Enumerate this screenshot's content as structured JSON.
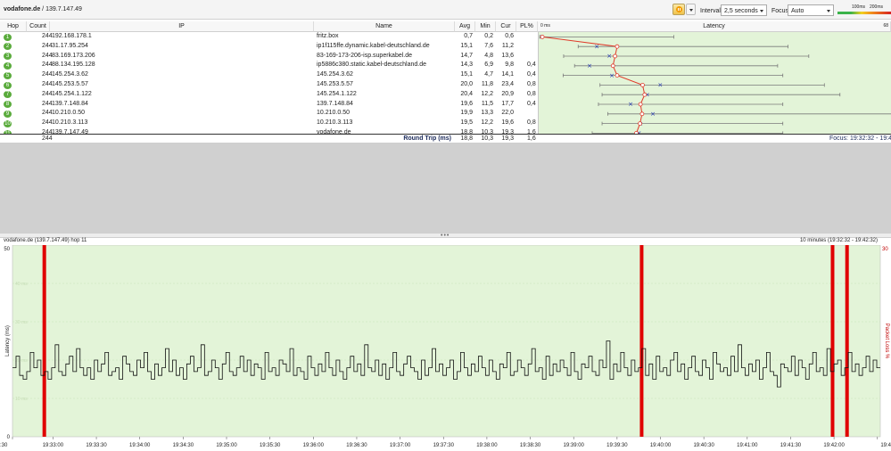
{
  "window": {
    "title_host": "vodafone.de",
    "title_ip": " / 139.7.147.49"
  },
  "toolbar": {
    "interval_label": "Interval",
    "interval_value": "2,5 seconds",
    "focus_label": "Focus",
    "focus_value": "Auto",
    "scale_100": "100ms",
    "scale_200": "200ms"
  },
  "table": {
    "headers": {
      "hop": "Hop",
      "count": "Count",
      "ip": "IP",
      "name": "Name",
      "avg": "Avg",
      "min": "Min",
      "cur": "Cur",
      "pl": "PL%",
      "latency": "Latency",
      "zero": "0 ms",
      "max": "68"
    },
    "rows": [
      {
        "hop": "1",
        "count": "244",
        "ip": "192.168.178.1",
        "name": "fritz.box",
        "avg": "0,7",
        "min": "0,2",
        "cur": "0,6",
        "pl": "",
        "pl_value": 0
      },
      {
        "hop": "2",
        "count": "244",
        "ip": "31.17.95.254",
        "name": "ip1f115ffe.dynamic.kabel-deutschland.de",
        "avg": "15,1",
        "min": "7,6",
        "cur": "11,2",
        "pl": "",
        "pl_value": 0
      },
      {
        "hop": "3",
        "count": "244",
        "ip": "83.169.173.206",
        "name": "83-169-173-206-isp.superkabel.de",
        "avg": "14,7",
        "min": "4,8",
        "cur": "13,6",
        "pl": "",
        "pl_value": 0
      },
      {
        "hop": "4",
        "count": "244",
        "ip": "88.134.195.128",
        "name": "ip5886c380.static.kabel-deutschland.de",
        "avg": "14,3",
        "min": "6,9",
        "cur": "9,8",
        "pl": "0,4",
        "pl_value": 0.4
      },
      {
        "hop": "5",
        "count": "244",
        "ip": "145.254.3.62",
        "name": "145.254.3.62",
        "avg": "15,1",
        "min": "4,7",
        "cur": "14,1",
        "pl": "0,4",
        "pl_value": 0.4
      },
      {
        "hop": "6",
        "count": "244",
        "ip": "145.253.5.57",
        "name": "145.253.5.57",
        "avg": "20,0",
        "min": "11,8",
        "cur": "23,4",
        "pl": "0,8",
        "pl_value": 0.8
      },
      {
        "hop": "7",
        "count": "244",
        "ip": "145.254.1.122",
        "name": "145.254.1.122",
        "avg": "20,4",
        "min": "12,2",
        "cur": "20,9",
        "pl": "0,8",
        "pl_value": 0.8
      },
      {
        "hop": "8",
        "count": "244",
        "ip": "139.7.148.84",
        "name": "139.7.148.84",
        "avg": "19,6",
        "min": "11,5",
        "cur": "17,7",
        "pl": "0,4",
        "pl_value": 0.4
      },
      {
        "hop": "9",
        "count": "244",
        "ip": "10.210.0.50",
        "name": "10.210.0.50",
        "avg": "19,9",
        "min": "13,3",
        "cur": "22,0",
        "pl": "",
        "pl_value": 0
      },
      {
        "hop": "10",
        "count": "244",
        "ip": "10.210.3.113",
        "name": "10.210.3.113",
        "avg": "19,5",
        "min": "12,2",
        "cur": "19,6",
        "pl": "0,8",
        "pl_value": 0.8
      },
      {
        "hop": "11",
        "count": "244",
        "ip": "139.7.147.49",
        "name": "vodafone.de",
        "avg": "18,8",
        "min": "10,3",
        "cur": "19,3",
        "pl": "1,6",
        "pl_value": 1.6
      }
    ],
    "summary": {
      "count": "244",
      "label": "Round Trip (ms)",
      "avg": "18,8",
      "min": "10,3",
      "cur": "19,3",
      "pl": "1,6",
      "focus": "Focus: 19:32:32 - 19:42:3"
    },
    "latency_graph": {
      "x_max_ms": 68,
      "max_ms": [
        26,
        48,
        52,
        46,
        47,
        55,
        58,
        47,
        70,
        47,
        47
      ],
      "min_ms": [
        0.2,
        7.6,
        4.8,
        6.9,
        4.7,
        11.8,
        12.2,
        11.5,
        13.3,
        12.2,
        10.3
      ]
    }
  },
  "chart_title": "vodafone.de (139.7.147.49) hop 11",
  "chart_range": "10 minutes (19:32:32 - 19:42:32)",
  "chart_data": {
    "type": "line",
    "ylabel": "Latency (ms)",
    "y2label": "Packet Loss %",
    "ylim": [
      0,
      50
    ],
    "y2_max_label": "30",
    "y_ticks": [
      "0",
      "50"
    ],
    "y_faint_ticks": [
      "10 ms",
      "20 ms",
      "30 ms",
      "40 ms"
    ],
    "x_ticks": [
      "19:32:30",
      "19:33:00",
      "19:33:30",
      "19:34:00",
      "19:34:30",
      "19:35:00",
      "19:35:30",
      "19:36:00",
      "19:36:30",
      "19:37:00",
      "19:37:30",
      "19:38:00",
      "19:38:30",
      "19:39:00",
      "19:39:30",
      "19:40:00",
      "19:40:30",
      "19:41:00",
      "19:41:30",
      "19:42:00",
      "19:42:30"
    ],
    "x_tick_display": [
      ":30",
      "19:33:00",
      "19:33:30",
      "19:34:00",
      "19:34:30",
      "19:35:00",
      "19:35:30",
      "19:36:00",
      "19:36:30",
      "19:37:00",
      "19:37:30",
      "19:38:00",
      "19:38:30",
      "19:39:00",
      "19:39:30",
      "19:40:00",
      "19:40:30",
      "19:41:00",
      "19:41:30",
      "19:42:00",
      "19:4"
    ],
    "time_range_s": [
      0,
      600
    ],
    "packet_loss_at_s": [
      22,
      435,
      567,
      577
    ],
    "latency_ms": [
      18,
      21,
      16,
      15,
      17,
      22,
      18,
      20,
      16,
      17,
      15,
      18,
      24,
      17,
      16,
      19,
      21,
      17,
      23,
      18,
      16,
      18,
      15,
      20,
      17,
      19,
      22,
      16,
      17,
      18,
      15,
      21,
      19,
      17,
      16,
      20,
      18,
      22,
      17,
      15,
      19,
      16,
      18,
      23,
      17,
      20,
      16,
      18,
      15,
      19,
      21,
      17,
      18,
      24,
      16,
      17,
      20,
      18,
      15,
      19,
      22,
      17,
      16,
      18,
      21,
      17,
      20,
      16,
      19,
      18,
      15,
      22,
      17,
      18,
      16,
      20,
      19,
      17,
      23,
      16,
      18,
      17,
      15,
      21,
      18,
      16,
      19,
      17,
      22,
      18,
      16,
      20,
      17,
      15,
      18,
      21,
      17,
      19,
      16,
      24,
      18,
      17,
      20,
      16,
      19,
      15,
      18,
      22,
      17,
      16,
      19,
      21,
      18,
      17,
      15,
      20,
      16,
      18,
      23,
      17,
      19,
      16,
      18,
      20,
      15,
      17,
      22,
      18,
      16,
      19,
      17,
      21,
      18,
      16,
      20,
      17,
      15,
      19,
      18,
      22,
      16,
      17,
      20,
      18,
      16,
      19,
      23,
      17,
      18,
      15,
      21,
      16,
      19,
      17,
      20,
      18,
      16,
      22,
      17,
      15,
      19,
      18,
      21,
      17,
      16,
      20,
      18,
      25,
      15,
      19,
      17,
      22,
      18,
      16,
      20,
      17,
      18,
      23,
      16,
      19,
      15,
      21,
      17,
      18,
      16,
      20,
      22,
      17,
      19,
      15,
      18,
      21,
      17,
      16,
      20,
      18,
      15,
      22,
      19,
      17,
      18,
      16,
      21,
      17,
      24,
      18,
      16,
      19,
      17,
      20,
      15,
      18,
      22,
      17,
      16,
      13,
      19,
      18,
      17,
      21,
      16,
      20,
      18,
      15,
      19,
      22,
      17,
      18,
      16,
      23,
      17,
      19,
      20,
      16,
      18,
      22,
      17,
      19,
      16,
      18,
      21,
      17,
      20,
      18
    ]
  }
}
